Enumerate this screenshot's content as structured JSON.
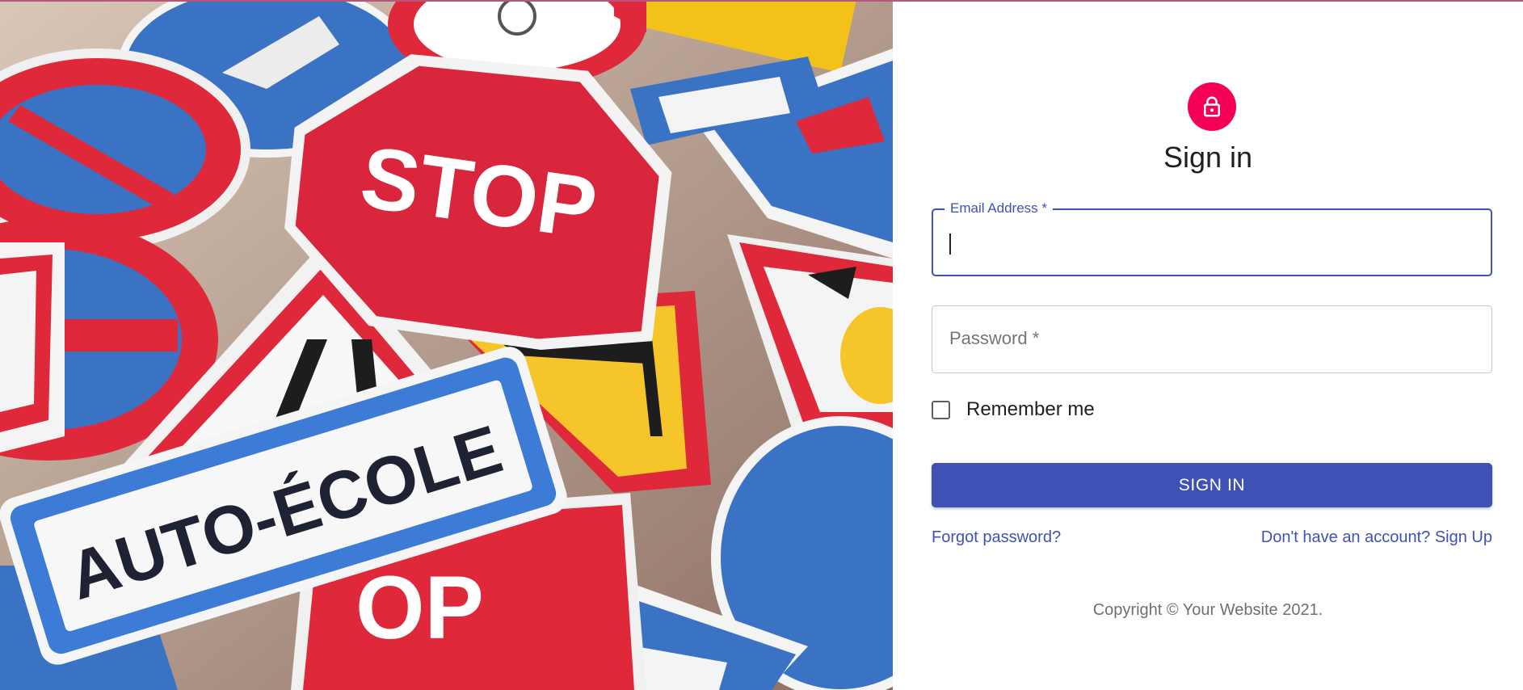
{
  "hero": {
    "stop_text": "STOP",
    "auto_ecole_text": "AUTO-ÉCOLE",
    "partial_sign_text": "OP"
  },
  "signin": {
    "title": "Sign in",
    "email": {
      "label": "Email Address *",
      "value": ""
    },
    "password": {
      "label": "Password *",
      "value": ""
    },
    "remember_label": "Remember me",
    "submit_label": "SIGN IN",
    "forgot_link": "Forgot password?",
    "signup_link": "Don't have an account? Sign Up",
    "copyright": "Copyright © Your Website 2021."
  },
  "colors": {
    "primary": "#3f51b5",
    "accent": "#f50057",
    "top_border": "#b4577a"
  },
  "icons": {
    "avatar": "lock-icon"
  }
}
